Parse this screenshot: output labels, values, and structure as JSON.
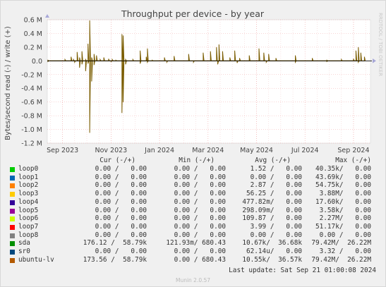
{
  "chart_data": {
    "type": "line",
    "title": "Throughput per device - by year",
    "ylabel": "Bytes/second read (-) / write (+)",
    "watermark": "RRDTOOL / TOBI OETIKER",
    "ylim": [
      -1.2,
      0.6
    ],
    "yunit": "M",
    "yticks": [
      "0.6 M",
      "0.4 M",
      "0.2 M",
      "0.0",
      "-0.2 M",
      "-0.4 M",
      "-0.6 M",
      "-0.8 M",
      "-1.0 M",
      "-1.2 M"
    ],
    "yvalues": [
      0.6,
      0.4,
      0.2,
      0.0,
      -0.2,
      -0.4,
      -0.6,
      -0.8,
      -1.0,
      -1.2
    ],
    "xticks": [
      "Sep 2023",
      "Nov 2023",
      "Jan 2024",
      "Mar 2024",
      "May 2024",
      "Jul 2024",
      "Sep 2024"
    ],
    "xtick_months": [
      0,
      2,
      4,
      6,
      8,
      10,
      12
    ],
    "xlim_months": [
      -0.63,
      12.7
    ],
    "grid": true,
    "series": [
      {
        "name": "ubuntu-lv",
        "color": "#7a5c00",
        "points_write": [
          [
            -0.6,
            0.01
          ],
          [
            0.1,
            0.02
          ],
          [
            0.35,
            0.06
          ],
          [
            0.45,
            0.02
          ],
          [
            0.6,
            0.13
          ],
          [
            0.7,
            0.05
          ],
          [
            0.8,
            0.14
          ],
          [
            0.95,
            0.02
          ],
          [
            1.05,
            0.25
          ],
          [
            1.12,
            0.59
          ],
          [
            1.2,
            0.05
          ],
          [
            1.3,
            0.1
          ],
          [
            1.4,
            0.08
          ],
          [
            1.55,
            0.02
          ],
          [
            1.7,
            0.05
          ],
          [
            1.9,
            0.03
          ],
          [
            2.05,
            0.02
          ],
          [
            2.2,
            0.01
          ],
          [
            2.45,
            0.39
          ],
          [
            2.5,
            0.37
          ],
          [
            2.6,
            0.02
          ],
          [
            2.9,
            0.02
          ],
          [
            3.2,
            0.15
          ],
          [
            3.45,
            0.06
          ],
          [
            3.5,
            0.18
          ],
          [
            3.7,
            0.01
          ],
          [
            4.2,
            0.05
          ],
          [
            4.6,
            0.07
          ],
          [
            5.2,
            0.1
          ],
          [
            5.8,
            0.12
          ],
          [
            6.1,
            0.14
          ],
          [
            6.35,
            0.2
          ],
          [
            6.45,
            0.24
          ],
          [
            6.6,
            0.14
          ],
          [
            6.9,
            0.05
          ],
          [
            7.1,
            0.15
          ],
          [
            7.3,
            0.04
          ],
          [
            7.7,
            0.08
          ],
          [
            8.1,
            0.18
          ],
          [
            8.3,
            0.12
          ],
          [
            8.5,
            0.1
          ],
          [
            8.8,
            0.04
          ],
          [
            9.6,
            0.08
          ],
          [
            10.3,
            0.04
          ],
          [
            10.9,
            0.01
          ],
          [
            11.5,
            0.02
          ],
          [
            12.0,
            0.03
          ],
          [
            12.1,
            0.15
          ],
          [
            12.2,
            0.2
          ],
          [
            12.3,
            0.12
          ],
          [
            12.45,
            0.06
          ]
        ],
        "points_read": [
          [
            -0.6,
            -0.01
          ],
          [
            0.5,
            -0.02
          ],
          [
            0.7,
            -0.1
          ],
          [
            0.8,
            -0.05
          ],
          [
            0.95,
            -0.15
          ],
          [
            1.05,
            -0.04
          ],
          [
            1.12,
            -1.05
          ],
          [
            1.2,
            -0.3
          ],
          [
            1.3,
            -0.06
          ],
          [
            2.0,
            -0.01
          ],
          [
            2.45,
            -0.76
          ],
          [
            2.5,
            -0.6
          ],
          [
            2.6,
            -0.05
          ],
          [
            3.2,
            -0.04
          ],
          [
            3.5,
            -0.02
          ],
          [
            4.3,
            -0.02
          ],
          [
            5.4,
            -0.02
          ],
          [
            6.4,
            -0.05
          ],
          [
            7.2,
            -0.03
          ],
          [
            8.4,
            -0.02
          ],
          [
            9.6,
            -0.02
          ],
          [
            10.9,
            -0.01
          ],
          [
            12.2,
            -0.02
          ]
        ]
      }
    ]
  },
  "legend": {
    "headers": {
      "cur": "Cur (-/+)",
      "min": "Min (-/+)",
      "avg": "Avg (-/+)",
      "max": "Max (-/+)"
    },
    "rows": [
      {
        "name": "loop0",
        "color": "#00cc00",
        "cur": "0.00 /   0.00",
        "min": "0.00 /   0.00",
        "avg": "1.52 /   0.00",
        "max": "40.35k/   0.00"
      },
      {
        "name": "loop1",
        "color": "#0066b3",
        "cur": "0.00 /   0.00",
        "min": "0.00 /   0.00",
        "avg": "0.00 /   0.00",
        "max": "43.69k/   0.00"
      },
      {
        "name": "loop2",
        "color": "#ff8000",
        "cur": "0.00 /   0.00",
        "min": "0.00 /   0.00",
        "avg": "2.87 /   0.00",
        "max": "54.75k/   0.00"
      },
      {
        "name": "loop3",
        "color": "#ffcc00",
        "cur": "0.00 /   0.00",
        "min": "0.00 /   0.00",
        "avg": "56.25 /   0.00",
        "max": "3.88M/   0.00"
      },
      {
        "name": "loop4",
        "color": "#330099",
        "cur": "0.00 /   0.00",
        "min": "0.00 /   0.00",
        "avg": "477.82m/   0.00",
        "max": "17.60k/   0.00"
      },
      {
        "name": "loop5",
        "color": "#990099",
        "cur": "0.00 /   0.00",
        "min": "0.00 /   0.00",
        "avg": "298.09m/   0.00",
        "max": "3.58k/   0.00"
      },
      {
        "name": "loop6",
        "color": "#ccff00",
        "cur": "0.00 /   0.00",
        "min": "0.00 /   0.00",
        "avg": "109.87 /   0.00",
        "max": "2.27M/   0.00"
      },
      {
        "name": "loop7",
        "color": "#ff0000",
        "cur": "0.00 /   0.00",
        "min": "0.00 /   0.00",
        "avg": "3.99 /   0.00",
        "max": "51.17k/   0.00"
      },
      {
        "name": "loop8",
        "color": "#808080",
        "cur": "0.00 /   0.00",
        "min": "0.00 /   0.00",
        "avg": "0.00 /   0.00",
        "max": "0.00 /   0.00"
      },
      {
        "name": "sda",
        "color": "#008f00",
        "cur": "176.12 /  58.79k",
        "min": "121.93m/ 680.43",
        "avg": "10.67k/  36.68k",
        "max": "79.42M/  26.22M"
      },
      {
        "name": "sr0",
        "color": "#00487d",
        "cur": "0.00 /   0.00",
        "min": "0.00 /   0.00",
        "avg": "62.14u/   0.00",
        "max": "3.32 /   0.00"
      },
      {
        "name": "ubuntu-lv",
        "color": "#b35a00",
        "cur": "173.56 /  58.79k",
        "min": "0.00 / 680.43",
        "avg": "10.55k/  36.57k",
        "max": "79.42M/  26.22M"
      }
    ]
  },
  "last_update": "Last update: Sat Sep 21 01:00:08 2024",
  "footer": "Munin 2.0.57"
}
